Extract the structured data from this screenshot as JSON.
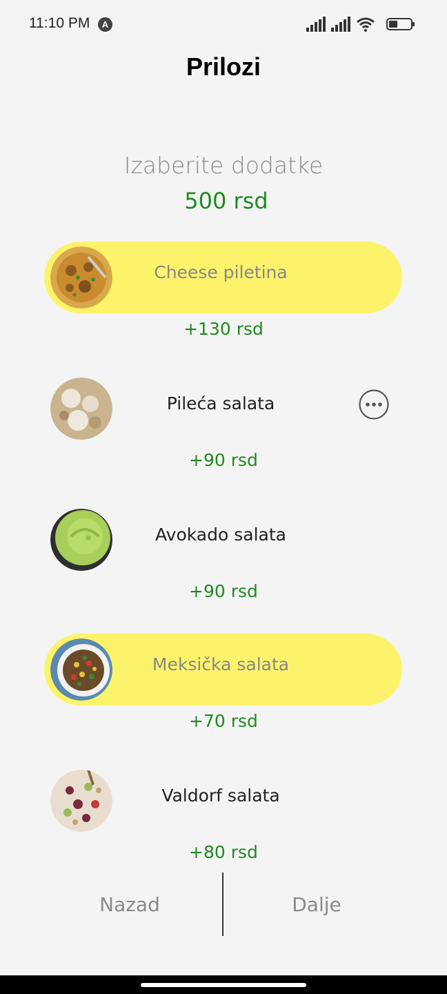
{
  "status": {
    "time": "11:10 PM",
    "app_icon": "A",
    "battery_level": "41"
  },
  "page_title": "Prilozi",
  "subtitle": "Izaberite dodatke",
  "base_price": "500 rsd",
  "items": [
    {
      "name": "Cheese piletina",
      "price": "+130 rsd",
      "selected": true,
      "image": "chicken-curry-photo"
    },
    {
      "name": "Pileća salata",
      "price": "+90 rsd",
      "selected": false,
      "image": "chicken-salad-photo",
      "has_more": true
    },
    {
      "name": "Avokado salata",
      "price": "+90 rsd",
      "selected": false,
      "image": "avocado-salad-photo"
    },
    {
      "name": "Meksička salata",
      "price": "+70 rsd",
      "selected": true,
      "image": "mexican-salad-photo"
    },
    {
      "name": "Valdorf salata",
      "price": "+80 rsd",
      "selected": false,
      "image": "waldorf-salad-photo"
    }
  ],
  "nav": {
    "back_label": "Nazad",
    "next_label": "Dalje"
  },
  "colors": {
    "selected_pill": "#fdf36b",
    "price_green": "#1f8a1f",
    "background": "#f4f4f4"
  }
}
